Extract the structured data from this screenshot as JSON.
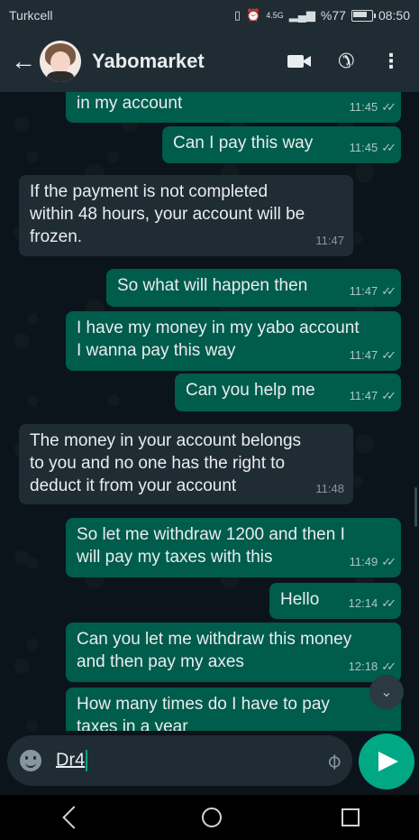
{
  "status_bar": {
    "carrier": "Turkcell",
    "network": "4.5G",
    "battery": "%77",
    "time": "08:50"
  },
  "header": {
    "contact_name": "Yabomarket",
    "icons": [
      "back-arrow-icon",
      "video-call-icon",
      "phone-icon",
      "more-options-icon"
    ]
  },
  "messages": [
    {
      "direction": "out",
      "text": "in my account",
      "time": "11:45",
      "ticks": "✓✓"
    },
    {
      "direction": "out",
      "text": "Can I pay this way",
      "time": "11:45",
      "ticks": "✓✓"
    },
    {
      "direction": "in",
      "text": "If the payment is not completed\nwithin 48 hours, your account will be\nfrozen.",
      "time": "11:47"
    },
    {
      "direction": "out",
      "text": "So what will happen then",
      "time": "11:47",
      "ticks": "✓✓"
    },
    {
      "direction": "out",
      "text": "I have my money in my yabo account\nI wanna pay this way",
      "time": "11:47",
      "ticks": "✓✓"
    },
    {
      "direction": "out",
      "text": "Can you help me",
      "time": "11:47",
      "ticks": "✓✓"
    },
    {
      "direction": "in",
      "text": "The money in your account belongs\nto you and no one has the right to\ndeduct it from your account",
      "time": "11:48"
    },
    {
      "direction": "out",
      "text": "So let me withdraw 1200 and then I\nwill pay my taxes with this",
      "time": "11:49",
      "ticks": "✓✓"
    },
    {
      "direction": "out",
      "text": "Hello",
      "time": "12:14",
      "ticks": "✓✓"
    },
    {
      "direction": "out",
      "text": "Can you let me withdraw this money\nand then pay my axes",
      "time": "12:18",
      "ticks": "✓✓"
    },
    {
      "direction": "out",
      "text": "How many times do I have to pay\ntaxes in a year",
      "time": "",
      "ticks": ""
    }
  ],
  "composer": {
    "value": "Dr4"
  },
  "colors": {
    "outgoing_bubble": "#005c4b",
    "incoming_bubble": "#202c33",
    "accent": "#00a884",
    "background": "#0b141a"
  }
}
